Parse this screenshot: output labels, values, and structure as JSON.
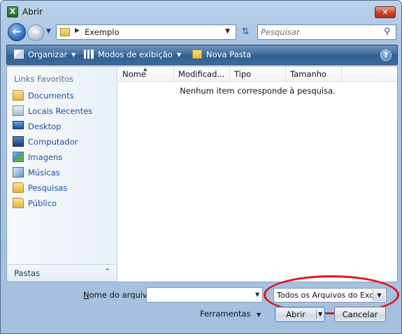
{
  "window": {
    "title": "Abrir",
    "app_icon": "excel-icon",
    "close_label": "✕"
  },
  "address_bar": {
    "path": "Exemplo",
    "search_placeholder": "Pesquisar"
  },
  "command_bar": {
    "organize_label": "Organizar",
    "views_label": "Modos de exibição",
    "new_folder_label": "Nova Pasta",
    "help_label": "?"
  },
  "nav_pane": {
    "heading": "Links Favoritos",
    "items": [
      {
        "label": "Documents",
        "icon": "folder-icon"
      },
      {
        "label": "Locais Recentes",
        "icon": "recent-places-icon"
      },
      {
        "label": "Desktop",
        "icon": "desktop-icon"
      },
      {
        "label": "Computador",
        "icon": "computer-icon"
      },
      {
        "label": "Imagens",
        "icon": "pictures-icon"
      },
      {
        "label": "Músicas",
        "icon": "music-icon"
      },
      {
        "label": "Pesquisas",
        "icon": "folder-icon"
      },
      {
        "label": "Público",
        "icon": "folder-icon"
      }
    ],
    "footer_label": "Pastas"
  },
  "file_list": {
    "columns": [
      "Nome",
      "Modificad...",
      "Tipo",
      "Tamanho"
    ],
    "empty_message": "Nenhum item corresponde à pesquisa."
  },
  "bottom": {
    "filename_label": "Nome do arquivo:",
    "filename_value": "",
    "filetype_value": "Todos os Arquivos do Excel (",
    "tools_label": "Ferramentas",
    "open_label": "Abrir",
    "cancel_label": "Cancelar"
  },
  "colors": {
    "highlight": "#e0141a",
    "link": "#1e50a2",
    "command_bar": "#3e6b9c"
  }
}
